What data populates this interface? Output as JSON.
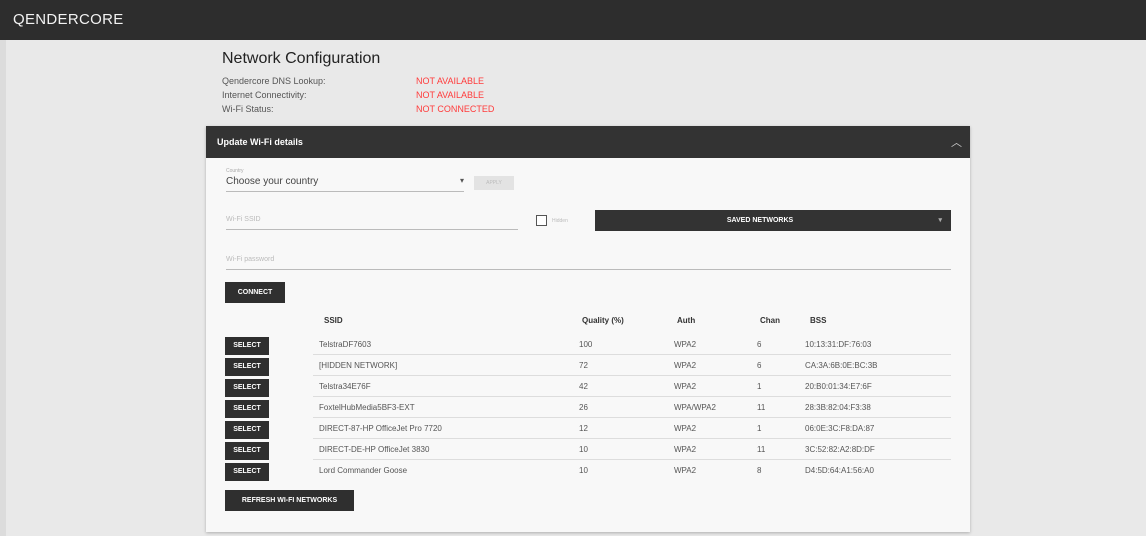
{
  "header": {
    "brand": "QENDERCORE"
  },
  "page": {
    "title": "Network Configuration",
    "status": [
      {
        "label": "Qendercore DNS Lookup:",
        "value": "NOT AVAILABLE"
      },
      {
        "label": "Internet Connectivity:",
        "value": "NOT AVAILABLE"
      },
      {
        "label": "Wi-Fi Status:",
        "value": "NOT CONNECTED"
      }
    ],
    "status_color": "#ff3b3b"
  },
  "panel": {
    "title": "Update Wi-Fi details",
    "country_label": "Country",
    "country_value": "Choose your country",
    "apply_label": "APPLY",
    "ssid_placeholder": "Wi-Fi SSID",
    "hidden_label": "Hidden",
    "saved_networks_label": "SAVED NETWORKS",
    "password_placeholder": "Wi-Fi password",
    "connect_label": "CONNECT",
    "refresh_label": "REFRESH WI-FI NETWORKS"
  },
  "table": {
    "headers": [
      "SSID",
      "Quality (%)",
      "Auth",
      "Chan",
      "BSS"
    ],
    "select_label": "SELECT",
    "rows": [
      {
        "ssid": "TelstraDF7603",
        "quality": "100",
        "auth": "WPA2",
        "chan": "6",
        "bss": "10:13:31:DF:76:03"
      },
      {
        "ssid": "[HIDDEN NETWORK]",
        "quality": "72",
        "auth": "WPA2",
        "chan": "6",
        "bss": "CA:3A:6B:0E:BC:3B"
      },
      {
        "ssid": "Telstra34E76F",
        "quality": "42",
        "auth": "WPA2",
        "chan": "1",
        "bss": "20:B0:01:34:E7:6F"
      },
      {
        "ssid": "FoxtelHubMedia5BF3-EXT",
        "quality": "26",
        "auth": "WPA/WPA2",
        "chan": "11",
        "bss": "28:3B:82:04:F3:38"
      },
      {
        "ssid": "DIRECT-87-HP OfficeJet Pro 7720",
        "quality": "12",
        "auth": "WPA2",
        "chan": "1",
        "bss": "06:0E:3C:F8:DA:87"
      },
      {
        "ssid": "DIRECT-DE-HP OfficeJet 3830",
        "quality": "10",
        "auth": "WPA2",
        "chan": "11",
        "bss": "3C:52:82:A2:8D:DF"
      },
      {
        "ssid": "Lord Commander Goose",
        "quality": "10",
        "auth": "WPA2",
        "chan": "8",
        "bss": "D4:5D:64:A1:56:A0"
      }
    ]
  }
}
